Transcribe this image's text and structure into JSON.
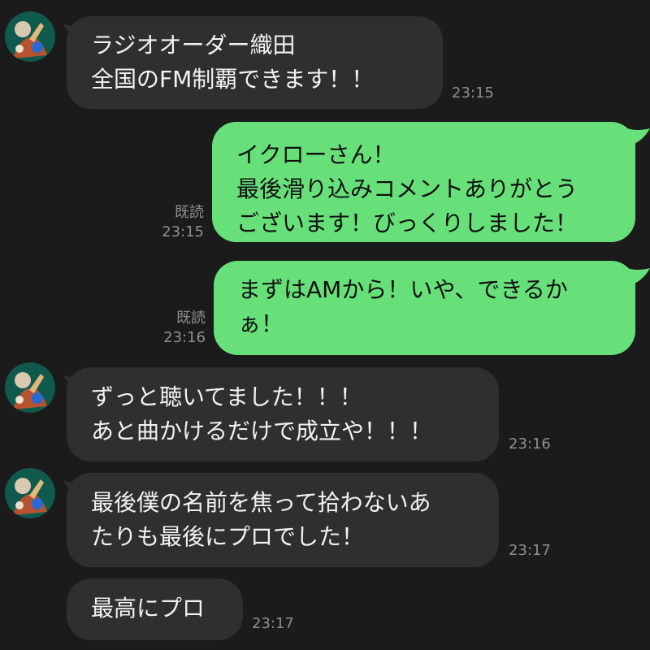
{
  "theme": {
    "background": "#1b1b1b",
    "incoming_bubble": "#2f2f2f",
    "outgoing_bubble": "#67e07a",
    "incoming_text": "#f2f2f2",
    "outgoing_text": "#101010",
    "meta_text": "#8e8e8e"
  },
  "messages": [
    {
      "direction": "incoming",
      "avatar_icon": "avatar-photo-icon",
      "text": "ラジオオーダー織田\n全国のFM制覇できます！！",
      "time": "23:15"
    },
    {
      "direction": "outgoing",
      "read": "既読",
      "text": "イクローさん！\n最後滑り込みコメントありがとう\nございます！びっくりしました！",
      "time": "23:15"
    },
    {
      "direction": "outgoing",
      "read": "既読",
      "text": "まずはAMから！いや、できるか\nぁ！",
      "time": "23:16"
    },
    {
      "direction": "incoming",
      "avatar_icon": "avatar-photo-icon",
      "text": "ずっと聴いてました！！！\nあと曲かけるだけで成立や！！！",
      "time": "23:16"
    },
    {
      "direction": "incoming",
      "avatar_icon": "avatar-photo-icon",
      "text": "最後僕の名前を焦って拾わないあ\nたりも最後にプロでした！",
      "time": "23:17"
    },
    {
      "direction": "incoming",
      "text": "最高にプロ",
      "time": "23:17"
    }
  ]
}
